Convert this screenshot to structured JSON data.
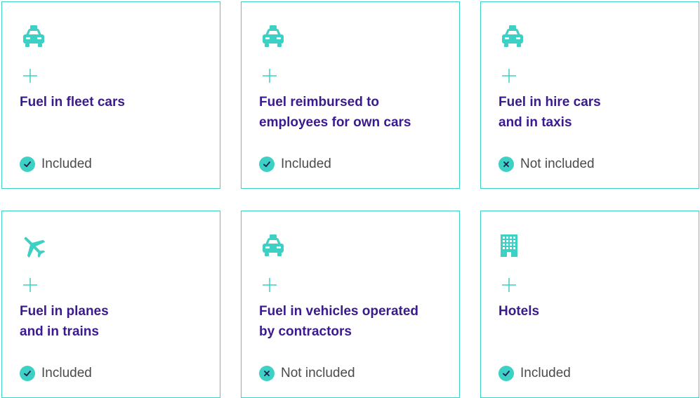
{
  "colors": {
    "accent": "#3cd1c4",
    "title": "#3b1a8f",
    "text": "#4a4a4a"
  },
  "cards": [
    {
      "icon": "taxi-icon",
      "title": "Fuel in fleet cars",
      "status": "Included",
      "status_icon": "check-icon"
    },
    {
      "icon": "taxi-icon",
      "title": "Fuel reimbursed to\nemployees for own cars",
      "status": "Included",
      "status_icon": "check-icon"
    },
    {
      "icon": "taxi-icon",
      "title": "Fuel in hire cars\nand in taxis",
      "status": "Not included",
      "status_icon": "cross-icon"
    },
    {
      "icon": "airplane-icon",
      "title": "Fuel in planes\nand in trains",
      "status": "Included",
      "status_icon": "check-icon"
    },
    {
      "icon": "taxi-icon",
      "title": "Fuel in vehicles operated\nby contractors",
      "status": "Not included",
      "status_icon": "cross-icon"
    },
    {
      "icon": "hotel-building-icon",
      "title": "Hotels",
      "status": "Included",
      "status_icon": "check-icon"
    }
  ]
}
